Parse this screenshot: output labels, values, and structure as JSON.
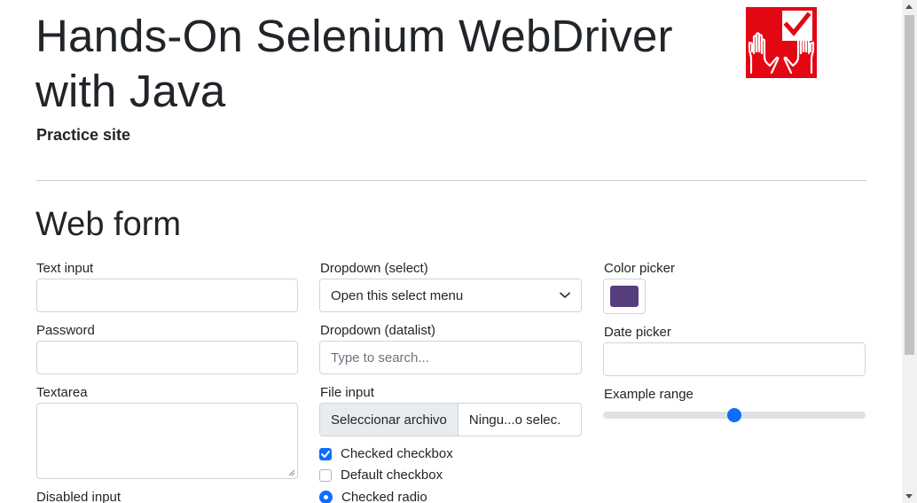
{
  "header": {
    "title_line1": "Hands-On Selenium WebDriver",
    "title_line2": "with Java",
    "subtitle": "Practice site",
    "logo_icon": "hands-checkmark-icon",
    "logo_color": "#e30613"
  },
  "form": {
    "title": "Web form",
    "text_input": {
      "label": "Text input",
      "value": ""
    },
    "password": {
      "label": "Password",
      "value": ""
    },
    "textarea": {
      "label": "Textarea",
      "value": ""
    },
    "disabled_input": {
      "label": "Disabled input"
    },
    "dropdown_select": {
      "label": "Dropdown (select)",
      "selected": "Open this select menu"
    },
    "dropdown_datalist": {
      "label": "Dropdown (datalist)",
      "placeholder": "Type to search..."
    },
    "file_input": {
      "label": "File input",
      "button": "Seleccionar archivo",
      "status": "Ningu...o selec."
    },
    "checkboxes": [
      {
        "label": "Checked checkbox",
        "checked": true
      },
      {
        "label": "Default checkbox",
        "checked": false
      }
    ],
    "radio": {
      "label": "Checked radio",
      "checked": true
    },
    "color_picker": {
      "label": "Color picker",
      "value": "#563d7c"
    },
    "date_picker": {
      "label": "Date picker",
      "value": ""
    },
    "range": {
      "label": "Example range",
      "value": 5,
      "min": 0,
      "max": 10
    }
  },
  "colors": {
    "accent": "#0d6efd",
    "text": "#212529",
    "border": "#ced4da"
  }
}
